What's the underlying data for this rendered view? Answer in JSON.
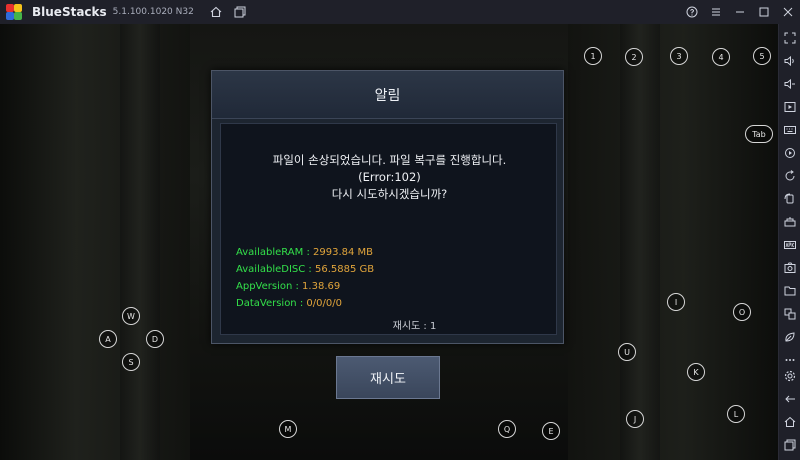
{
  "titlebar": {
    "app_name": "BlueStacks",
    "version": "5.1.100.1020 N32"
  },
  "dialog": {
    "title": "알림",
    "message_line1": "파일이 손상되었습니다. 파일 복구를 진행합니다.",
    "message_line2": "(Error:102)",
    "message_line3": "다시 시도하시겠습니까?",
    "info": [
      {
        "label": "AvailableRAM : ",
        "value": "2993.84 MB"
      },
      {
        "label": "AvailableDISC : ",
        "value": "56.5885 GB"
      },
      {
        "label": "AppVersion : ",
        "value": "1.38.69"
      },
      {
        "label": "DataVersion : ",
        "value": "0/0/0/0"
      }
    ],
    "retry_count": "재시도 : 1",
    "retry_button": "재시도"
  },
  "keymap": {
    "k1": "1",
    "k2": "2",
    "k3": "3",
    "k4": "4",
    "k5": "5",
    "tab": "Tab",
    "w": "W",
    "a": "A",
    "s": "S",
    "d": "D",
    "i": "I",
    "o": "O",
    "u": "U",
    "k": "K",
    "j": "J",
    "l": "L",
    "m": "M",
    "q": "Q",
    "e": "E"
  },
  "colors": {
    "info_label": "#33e04a",
    "info_value": "#e0a43b",
    "titlebar_bg": "#1f2029"
  },
  "icons": {
    "titlebar_left": [
      "home-icon",
      "multi-instance-icon"
    ],
    "titlebar_right": [
      "help-icon",
      "menu-icon",
      "minimize-icon",
      "maximize-icon",
      "close-icon"
    ],
    "sidebar": [
      "fullscreen-icon",
      "volume-up-icon",
      "volume-down-icon",
      "media-icon",
      "keyboard-icon",
      "macro-icon",
      "sync-icon",
      "rotate-icon",
      "shake-icon",
      "apk-icon",
      "screenshot-icon",
      "folder-icon",
      "multi-window-icon",
      "eco-mode-icon",
      "more-icon",
      "settings-icon",
      "back-icon",
      "home-icon",
      "recent-apps-icon"
    ]
  }
}
